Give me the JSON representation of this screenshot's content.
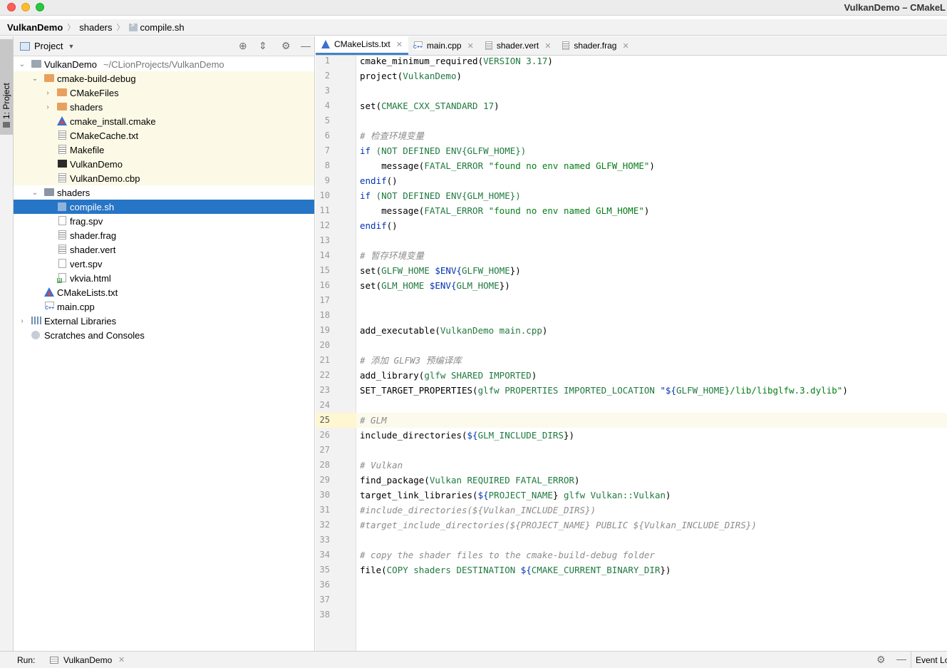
{
  "window": {
    "title": "VulkanDemo – CMakeL"
  },
  "breadcrumb": {
    "items": [
      "VulkanDemo",
      "shaders",
      "compile.sh"
    ]
  },
  "left_stripe": {
    "tab_label": "1: Project"
  },
  "project_panel": {
    "title": "Project",
    "tree": [
      {
        "label": "VulkanDemo",
        "path": "~/CLionProjects/VulkanDemo",
        "icon": "folder-icon",
        "expanded": true
      },
      {
        "label": "cmake-build-debug",
        "icon": "folder-icon",
        "expanded": true
      },
      {
        "label": "CMakeFiles",
        "icon": "folder-icon",
        "expanded": false
      },
      {
        "label": "shaders",
        "icon": "folder-icon",
        "expanded": false
      },
      {
        "label": "cmake_install.cmake",
        "icon": "cmake-icon"
      },
      {
        "label": "CMakeCache.txt",
        "icon": "text-file-icon"
      },
      {
        "label": "Makefile",
        "icon": "text-file-icon"
      },
      {
        "label": "VulkanDemo",
        "icon": "executable-icon"
      },
      {
        "label": "VulkanDemo.cbp",
        "icon": "text-file-icon"
      },
      {
        "label": "shaders",
        "icon": "folder-icon",
        "expanded": true
      },
      {
        "label": "compile.sh",
        "icon": "shell-script-icon",
        "selected": true
      },
      {
        "label": "frag.spv",
        "icon": "file-icon"
      },
      {
        "label": "shader.frag",
        "icon": "text-file-icon"
      },
      {
        "label": "shader.vert",
        "icon": "text-file-icon"
      },
      {
        "label": "vert.spv",
        "icon": "file-icon"
      },
      {
        "label": "vkvia.html",
        "icon": "html-file-icon"
      },
      {
        "label": "CMakeLists.txt",
        "icon": "cmake-icon"
      },
      {
        "label": "main.cpp",
        "icon": "cpp-file-icon"
      },
      {
        "label": "External Libraries",
        "icon": "library-icon",
        "expanded": false
      },
      {
        "label": "Scratches and Consoles",
        "icon": "scratch-icon"
      }
    ]
  },
  "editor": {
    "tabs": [
      {
        "label": "CMakeLists.txt",
        "icon": "cmake-icon",
        "active": true
      },
      {
        "label": "main.cpp",
        "icon": "cpp-file-icon",
        "active": false
      },
      {
        "label": "shader.vert",
        "icon": "text-file-icon",
        "active": false
      },
      {
        "label": "shader.frag",
        "icon": "text-file-icon",
        "active": false
      }
    ],
    "current_line": 25,
    "line_numbers": [
      "1",
      "2",
      "3",
      "4",
      "5",
      "6",
      "7",
      "8",
      "9",
      "10",
      "11",
      "12",
      "13",
      "14",
      "15",
      "16",
      "17",
      "18",
      "19",
      "20",
      "21",
      "22",
      "23",
      "24",
      "25",
      "26",
      "27",
      "28",
      "29",
      "30",
      "31",
      "32",
      "33",
      "34",
      "35",
      "36",
      "37",
      "38"
    ],
    "code": {
      "l1_a": "cmake_minimum_required(",
      "l1_b": "VERSION 3.17",
      "l1_c": ")",
      "l2_a": "project(",
      "l2_b": "VulkanDemo",
      "l2_c": ")",
      "l4_a": "set(",
      "l4_b": "CMAKE_CXX_STANDARD 17",
      "l4_c": ")",
      "l6": "# 检查环境变量",
      "l7_a": "if",
      "l7_b": " (NOT DEFINED ENV{GLFW_HOME})",
      "l8_a": "    message(",
      "l8_b": "FATAL_ERROR ",
      "l8_c": "\"found no env named GLFW_HOME\"",
      "l8_d": ")",
      "l9_a": "endif",
      "l9_b": "()",
      "l10_a": "if",
      "l10_b": " (NOT DEFINED ENV{GLM_HOME})",
      "l11_a": "    message(",
      "l11_b": "FATAL_ERROR ",
      "l11_c": "\"found no env named GLM_HOME\"",
      "l11_d": ")",
      "l12_a": "endif",
      "l12_b": "()",
      "l14": "# 暂存环境变量",
      "l15_a": "set(",
      "l15_b": "GLFW_HOME ",
      "l15_c": "$ENV{",
      "l15_d": "GLFW_HOME",
      "l15_e": "})",
      "l16_a": "set(",
      "l16_b": "GLM_HOME ",
      "l16_c": "$ENV{",
      "l16_d": "GLM_HOME",
      "l16_e": "})",
      "l19_a": "add_executable(",
      "l19_b": "VulkanDemo main.cpp",
      "l19_c": ")",
      "l21": "# 添加 GLFW3 预编译库",
      "l22_a": "add_library(",
      "l22_b": "glfw SHARED IMPORTED",
      "l22_c": ")",
      "l23_a": "SET_TARGET_PROPERTIES(",
      "l23_b": "glfw PROPERTIES IMPORTED_LOCATION ",
      "l23_c": "\"${",
      "l23_d": "GLFW_HOME",
      "l23_e": "}/lib/libglfw.3.dylib\"",
      "l23_f": ")",
      "l25": "# GLM",
      "l26_a": "include_directories(",
      "l26_b": "${",
      "l26_c": "GLM_INCLUDE_DIRS",
      "l26_d": "})",
      "l28": "# Vulkan",
      "l29_a": "find_package(",
      "l29_b": "Vulkan REQUIRED FATAL_ERROR",
      "l29_c": ")",
      "l30_a": "target_link_libraries(",
      "l30_b": "${",
      "l30_c": "PROJECT_NAME",
      "l30_d": "} ",
      "l30_e": "glfw Vulkan::Vulkan",
      "l30_f": ")",
      "l31": "#include_directories(${Vulkan_INCLUDE_DIRS})",
      "l32": "#target_include_directories(${PROJECT_NAME} PUBLIC ${Vulkan_INCLUDE_DIRS})",
      "l34": "# copy the shader files to the cmake-build-debug folder",
      "l35_a": "file(",
      "l35_b": "COPY shaders DESTINATION ",
      "l35_c": "${",
      "l35_d": "CMAKE_CURRENT_BINARY_DIR",
      "l35_e": "})"
    }
  },
  "bottom_bar": {
    "run_label": "Run:",
    "run_config": "VulkanDemo",
    "event_log": "Event Lo"
  }
}
